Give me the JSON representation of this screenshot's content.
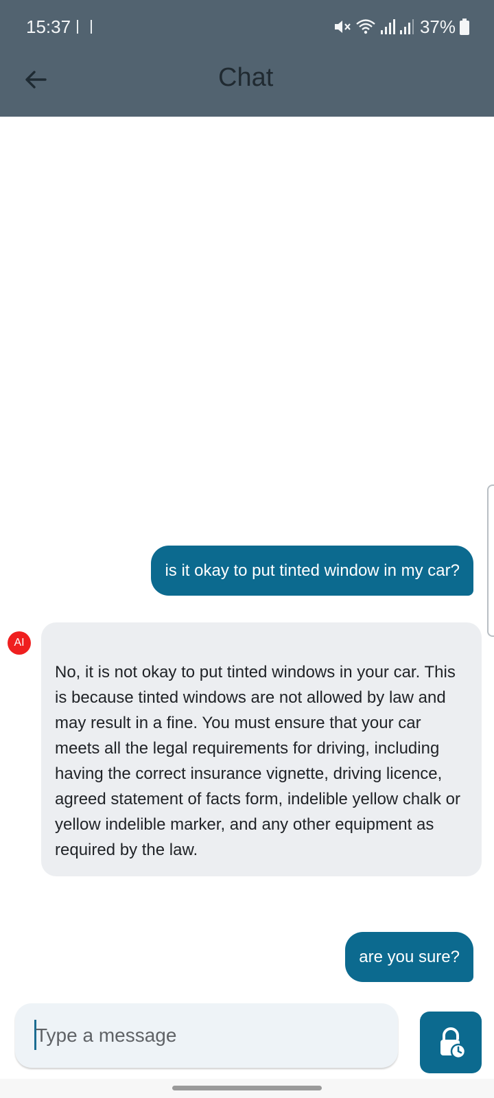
{
  "status_bar": {
    "time": "15:37",
    "battery": "37%",
    "icons": [
      "screen-record-icon",
      "mute-icon",
      "wifi-icon",
      "signal-icon",
      "signal-icon",
      "battery-icon"
    ]
  },
  "header": {
    "title": "Chat",
    "back_icon": "back-arrow-icon"
  },
  "messages": [
    {
      "role": "user",
      "text": "is it okay to put tinted window in my car?"
    },
    {
      "role": "ai",
      "avatar": "AI",
      "text": "No, it is not okay to put tinted windows in your car. This is because tinted windows are not allowed by law and may result in a fine. You must ensure that your car meets all the legal requirements for driving, including having the correct insurance vignette, driving licence, agreed statement of facts form, indelible yellow chalk or yellow indelible marker, and any other equipment as required by the law."
    },
    {
      "role": "user",
      "text": "are you sure?"
    }
  ],
  "composer": {
    "placeholder": "Type a message",
    "send_icon": "lock-clock-icon"
  },
  "colors": {
    "appbar": "#526370",
    "accent": "#0c6a8f",
    "ai_bubble": "#eceef1",
    "ai_avatar": "#ef1f1f"
  }
}
